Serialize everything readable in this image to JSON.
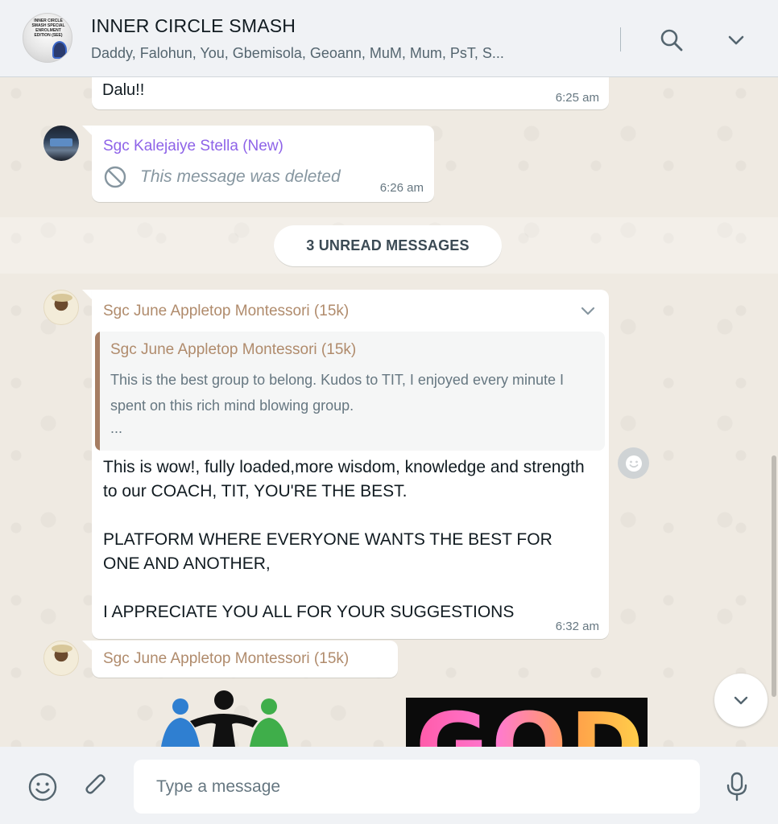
{
  "header": {
    "group_name": "INNER CIRCLE SMASH",
    "participants": "Daddy, Falohun, You, Gbemisola, Geoann, MuM, Mum, PsT, S...",
    "avatar_text": "INNER CIRCLE SMASH SPECIAL ENROLMENT EDITION (SEE)"
  },
  "messages": {
    "m1": {
      "text": "Dalu!!",
      "time": "6:25 am"
    },
    "m2": {
      "sender": "Sgc Kalejaiye Stella (New)",
      "deleted_text": "This message was deleted",
      "time": "6:26 am"
    },
    "unread_label": "3 UNREAD MESSAGES",
    "m3": {
      "sender": "Sgc June Appletop Montessori (15k)",
      "quote": {
        "sender": "Sgc June Appletop Montessori (15k)",
        "text": "This is the best group to belong. Kudos to TIT, I enjoyed every minute I spent on this rich mind blowing group.",
        "more": "..."
      },
      "body": "This is wow!, fully loaded,more wisdom, knowledge and strength to our COACH, TIT, YOU'RE THE BEST.\n\nPLATFORM WHERE EVERYONE WANTS THE BEST FOR ONE AND  ANOTHER,\n\nI APPRECIATE YOU ALL FOR  YOUR SUGGESTIONS",
      "time": "6:32 am"
    },
    "m4": {
      "sender": "Sgc June Appletop Montessori (15k)",
      "image_text": "GOD"
    }
  },
  "composer": {
    "placeholder": "Type a message"
  },
  "icons": {
    "search": "search-icon",
    "menu": "chevron-down-icon",
    "deleted": "blocked-icon",
    "emoji": "emoji-icon",
    "attach": "paperclip-icon",
    "mic": "microphone-icon",
    "scroll": "chevron-down-icon"
  },
  "colors": {
    "sender_stella": "#8e63e8",
    "sender_june": "#b08b6c",
    "chat_bg": "#efeae2",
    "header_bg": "#f0f2f5"
  }
}
